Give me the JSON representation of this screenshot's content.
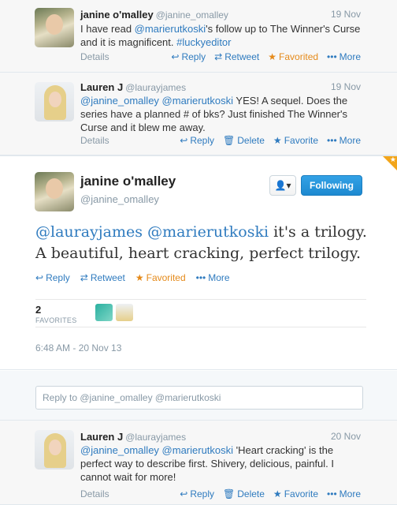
{
  "tweets_top": [
    {
      "name": "janine o'malley",
      "handle": "@janine_omalley",
      "date": "19 Nov",
      "text_parts": [
        "I have read ",
        "@marierutkoski",
        "'s follow up to The Winner's Curse and it is magnificent. ",
        "#luckyeditor"
      ],
      "actions": {
        "details": "Details",
        "reply": "Reply",
        "retweet": "Retweet",
        "favorite": "Favorited",
        "more": "More"
      }
    },
    {
      "name": "Lauren J",
      "handle": "@laurayjames",
      "date": "19 Nov",
      "text_parts": [
        "@janine_omalley",
        " ",
        "@marierutkoski",
        " YES! A sequel. Does the series have a planned # of bks? Just finished The Winner's Curse and it blew me away."
      ],
      "actions": {
        "details": "Details",
        "reply": "Reply",
        "delete": "Delete",
        "favorite": "Favorite",
        "more": "More"
      }
    }
  ],
  "main_tweet": {
    "name": "janine o'malley",
    "handle": "@janine_omalley",
    "mention1": "@laurayjames",
    "mention2": "@marierutkoski",
    "text": " it's a trilogy. A beautiful, heart cracking, perfect trilogy.",
    "follow_label": "Following",
    "actions": {
      "reply": "Reply",
      "retweet": "Retweet",
      "favorite": "Favorited",
      "more": "More"
    },
    "favorites_count": "2",
    "favorites_label": "FAVORITES",
    "timestamp": "6:48 AM - 20 Nov 13"
  },
  "reply_box": {
    "placeholder": "Reply to @janine_omalley @marierutkoski"
  },
  "tweet_bottom": {
    "name": "Lauren J",
    "handle": "@laurayjames",
    "date": "20 Nov",
    "text_parts": [
      "@janine_omalley",
      " ",
      "@marierutkoski",
      " 'Heart cracking' is the perfect way to describe first. Shivery, delicious, painful. I cannot wait for more!"
    ],
    "actions": {
      "details": "Details",
      "reply": "Reply",
      "delete": "Delete",
      "favorite": "Favorite",
      "more": "More"
    }
  },
  "colors": {
    "link": "#2f7bbf",
    "favorited": "#e58a1a",
    "follow_button": "#1d89d0"
  }
}
